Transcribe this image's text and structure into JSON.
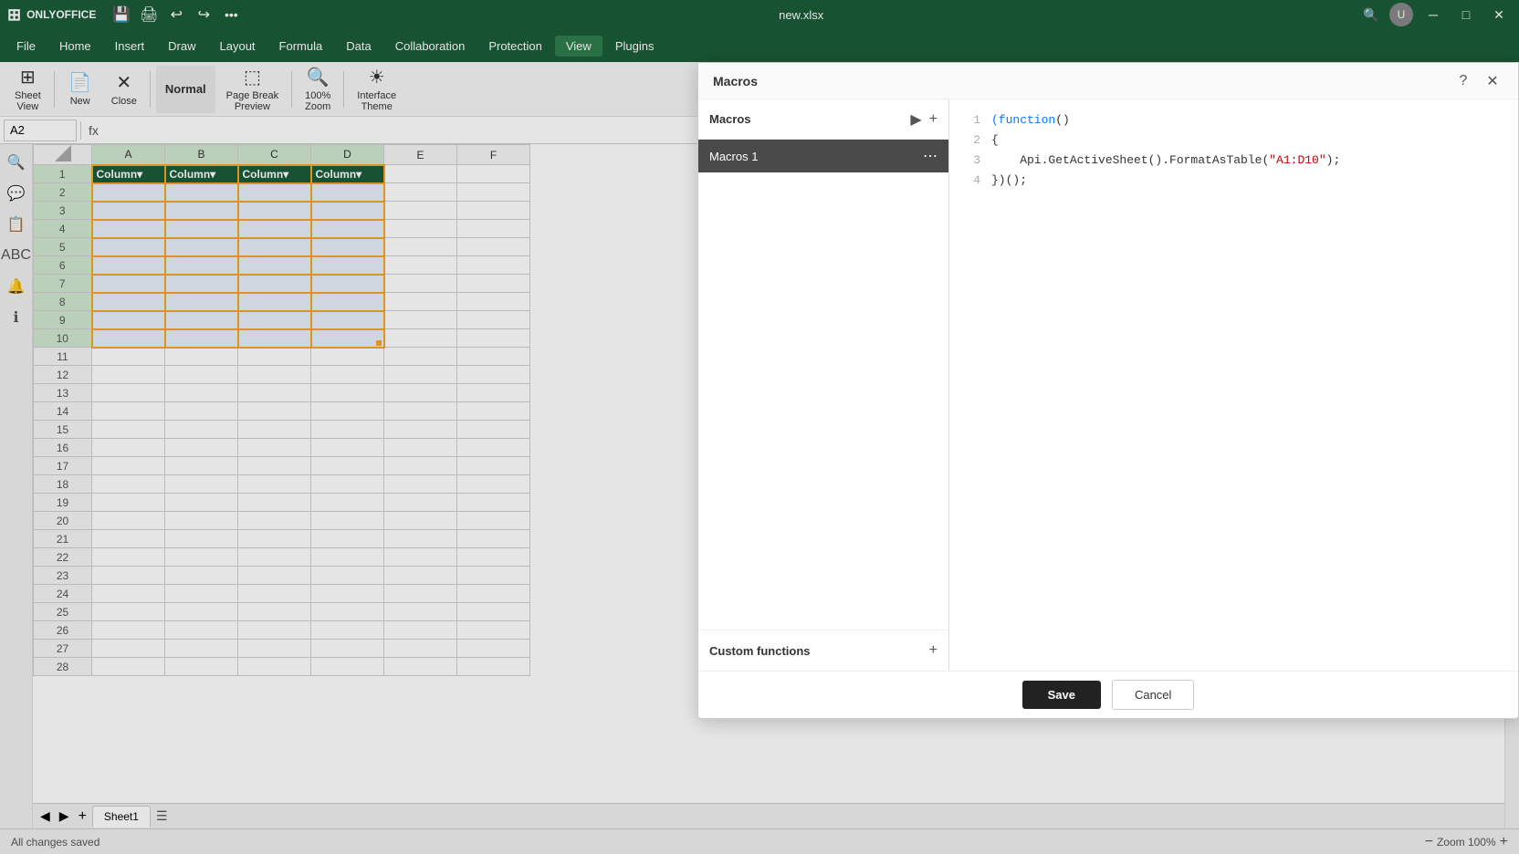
{
  "app": {
    "name": "ONLYOFFICE",
    "title": "new.xlsx"
  },
  "titlebar": {
    "save_icon": "💾",
    "print_icon": "🖨",
    "undo_icon": "↩",
    "redo_icon": "↪",
    "more_icon": "•••",
    "search_icon": "🔍",
    "avatar_label": "U"
  },
  "menu": {
    "items": [
      "File",
      "Home",
      "Insert",
      "Draw",
      "Layout",
      "Formula",
      "Data",
      "Collaboration",
      "Protection",
      "View",
      "Plugins"
    ],
    "active": "View"
  },
  "toolbar": {
    "sheet_view_label": "Sheet\nView",
    "new_label": "New",
    "close_label": "Close",
    "normal_label": "Normal",
    "page_break_label": "Page Break\nPreview",
    "zoom_label": "Zoom",
    "zoom_value": "100%",
    "interface_theme_label": "Interface\nTheme"
  },
  "formula_bar": {
    "cell_ref": "A2",
    "fx_icon": "fx",
    "formula_value": ""
  },
  "spreadsheet": {
    "col_headers": [
      "",
      "A",
      "B",
      "C",
      "D",
      "E",
      "F"
    ],
    "rows": [
      [
        "1",
        "Column▼",
        "Column▼",
        "Column▼",
        "Column▼",
        "",
        ""
      ],
      [
        "2",
        "",
        "",
        "",
        "",
        "",
        ""
      ],
      [
        "3",
        "",
        "",
        "",
        "",
        "",
        ""
      ],
      [
        "4",
        "",
        "",
        "",
        "",
        "",
        ""
      ],
      [
        "5",
        "",
        "",
        "",
        "",
        "",
        ""
      ],
      [
        "6",
        "",
        "",
        "",
        "",
        "",
        ""
      ],
      [
        "7",
        "",
        "",
        "",
        "",
        "",
        ""
      ],
      [
        "8",
        "",
        "",
        "",
        "",
        "",
        ""
      ],
      [
        "9",
        "",
        "",
        "",
        "",
        "",
        ""
      ],
      [
        "10",
        "",
        "",
        "",
        "",
        "",
        ""
      ],
      [
        "11",
        "",
        "",
        "",
        "",
        "",
        ""
      ],
      [
        "12",
        "",
        "",
        "",
        "",
        "",
        ""
      ],
      [
        "13",
        "",
        "",
        "",
        "",
        "",
        ""
      ],
      [
        "14",
        "",
        "",
        "",
        "",
        "",
        ""
      ],
      [
        "15",
        "",
        "",
        "",
        "",
        "",
        ""
      ],
      [
        "16",
        "",
        "",
        "",
        "",
        "",
        ""
      ],
      [
        "17",
        "",
        "",
        "",
        "",
        "",
        ""
      ],
      [
        "18",
        "",
        "",
        "",
        "",
        "",
        ""
      ],
      [
        "19",
        "",
        "",
        "",
        "",
        "",
        ""
      ],
      [
        "20",
        "",
        "",
        "",
        "",
        "",
        ""
      ],
      [
        "21",
        "",
        "",
        "",
        "",
        "",
        ""
      ],
      [
        "22",
        "",
        "",
        "",
        "",
        "",
        ""
      ],
      [
        "23",
        "",
        "",
        "",
        "",
        "",
        ""
      ],
      [
        "24",
        "",
        "",
        "",
        "",
        "",
        ""
      ],
      [
        "25",
        "",
        "",
        "",
        "",
        "",
        ""
      ],
      [
        "26",
        "",
        "",
        "",
        "",
        "",
        ""
      ],
      [
        "27",
        "",
        "",
        "",
        "",
        "",
        ""
      ],
      [
        "28",
        "",
        "",
        "",
        "",
        "",
        ""
      ]
    ],
    "selected_range": "A1:D12",
    "sheet_tabs": [
      "Sheet1"
    ],
    "active_tab": "Sheet1"
  },
  "macros_dialog": {
    "title": "Macros",
    "help_icon": "?",
    "close_icon": "✕",
    "section_macros": "Macros",
    "run_icon": "▶",
    "add_icon": "+",
    "macros_list": [
      {
        "name": "Macros 1",
        "selected": true
      }
    ],
    "section_custom_functions": "Custom functions",
    "custom_functions_add_icon": "+",
    "code_lines": [
      {
        "num": "1",
        "code": "(function()",
        "type": "keyword_paren"
      },
      {
        "num": "2",
        "code": "{",
        "type": "brace"
      },
      {
        "num": "3",
        "code": "    Api.GetActiveSheet().FormatAsTable(\"A1:D10\");",
        "type": "normal_with_string"
      },
      {
        "num": "4",
        "code": "})();",
        "type": "normal"
      }
    ],
    "save_label": "Save",
    "cancel_label": "Cancel"
  },
  "status_bar": {
    "status_text": "All changes saved",
    "zoom_minus": "−",
    "zoom_level": "Zoom 100%",
    "zoom_plus": "+"
  }
}
